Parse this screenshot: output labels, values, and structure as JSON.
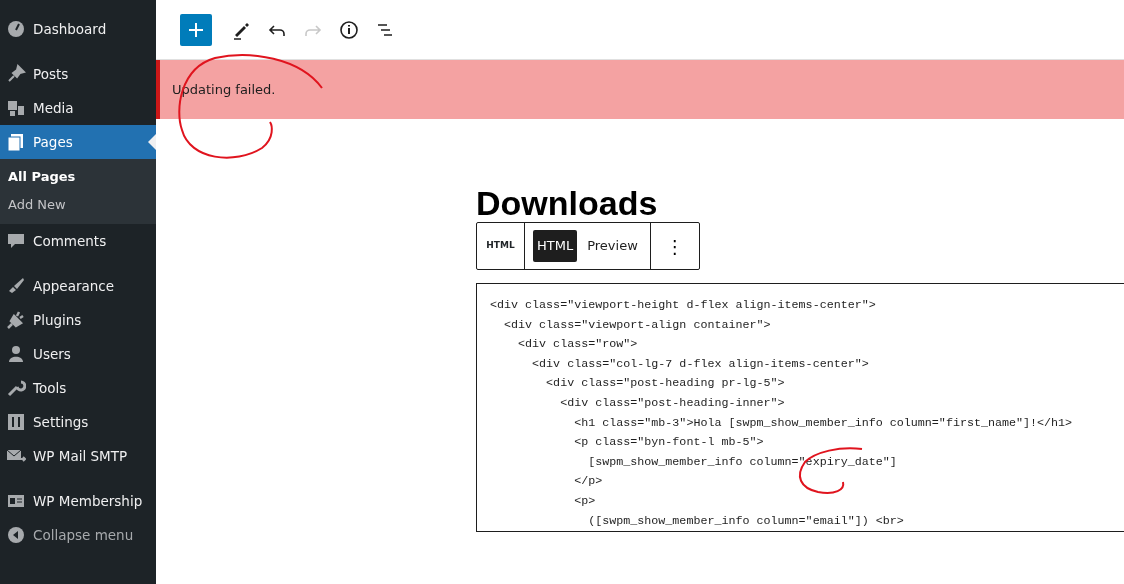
{
  "sidebar": {
    "items": [
      {
        "label": "Dashboard",
        "selected": false,
        "kind": "menu"
      },
      {
        "label": "Posts",
        "selected": false,
        "kind": "menu"
      },
      {
        "label": "Media",
        "selected": false,
        "kind": "menu"
      },
      {
        "label": "Pages",
        "selected": true,
        "kind": "menu",
        "children": [
          {
            "label": "All Pages",
            "selected": true
          },
          {
            "label": "Add New",
            "selected": false
          }
        ]
      },
      {
        "label": "Comments",
        "selected": false,
        "kind": "menu"
      },
      {
        "label": "Appearance",
        "selected": false,
        "kind": "menu"
      },
      {
        "label": "Plugins",
        "selected": false,
        "kind": "menu"
      },
      {
        "label": "Users",
        "selected": false,
        "kind": "menu"
      },
      {
        "label": "Tools",
        "selected": false,
        "kind": "menu"
      },
      {
        "label": "Settings",
        "selected": false,
        "kind": "menu"
      },
      {
        "label": "WP Mail SMTP",
        "selected": false,
        "kind": "menu"
      },
      {
        "label": "WP Membership",
        "selected": false,
        "kind": "menu"
      },
      {
        "label": "Collapse menu",
        "selected": false,
        "kind": "collapse"
      }
    ]
  },
  "toolbar": {
    "buttons": [
      {
        "kind": "add",
        "disabled": false
      },
      {
        "kind": "edit",
        "disabled": false
      },
      {
        "kind": "undo",
        "disabled": false
      },
      {
        "kind": "redo",
        "disabled": true
      },
      {
        "kind": "info",
        "disabled": false
      },
      {
        "kind": "outline",
        "disabled": false
      }
    ]
  },
  "notice": {
    "text": "Updating failed."
  },
  "page": {
    "title": "Downloads"
  },
  "block_toolbar": {
    "block_label": "HTML",
    "tabs": [
      {
        "label": "HTML",
        "selected": true
      },
      {
        "label": "Preview",
        "selected": false
      }
    ],
    "more": "⋮"
  },
  "code": {
    "lines": [
      "<div class=\"viewport-height d-flex align-items-center\">",
      "  <div class=\"viewport-align container\">",
      "    <div class=\"row\">",
      "      <div class=\"col-lg-7 d-flex align-items-center\">",
      "        <div class=\"post-heading pr-lg-5\">",
      "          <div class=\"post-heading-inner\">",
      "            <h1 class=\"mb-3\">Hola [swpm_show_member_info column=\"first_name\"]!</h1>",
      "            <p class=\"byn-font-l mb-5\">",
      "              [swpm_show_member_info column=\"expiry_date\"]",
      "            </p>",
      "            <p>",
      "              ([swpm_show_member_info column=\"email\"]) <br>"
    ]
  }
}
